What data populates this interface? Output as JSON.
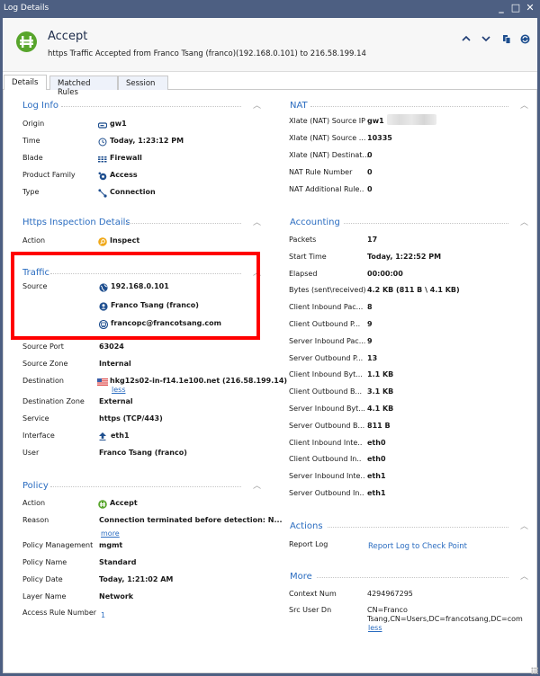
{
  "window": {
    "title": "Log Details",
    "controls": {
      "minimize": "_",
      "maximize": "□",
      "close": "✕"
    }
  },
  "header": {
    "title": "Accept",
    "subtitle": "https Traffic Accepted from Franco Tsang (franco)(192.168.0.101) to 216.58.199.14",
    "icon": "accept-gate-icon",
    "buttons": [
      {
        "name": "previous-log-button",
        "icon": "chevron-up-icon"
      },
      {
        "name": "next-log-button",
        "icon": "chevron-down-icon"
      },
      {
        "name": "copy-button",
        "icon": "copy-icon"
      },
      {
        "name": "refresh-button",
        "icon": "sync-icon"
      }
    ]
  },
  "tabs": [
    {
      "label": "Details",
      "active": true
    },
    {
      "label": "Matched Rules",
      "active": false
    },
    {
      "label": "Session",
      "active": false
    }
  ],
  "left": {
    "log_info": {
      "title": "Log Info",
      "rows": [
        {
          "label": "Origin",
          "value": "gw1",
          "icon": "gateway-icon"
        },
        {
          "label": "Time",
          "value": "Today, 1:23:12 PM",
          "icon": "clock-icon"
        },
        {
          "label": "Blade",
          "value": "Firewall",
          "icon": "firewall-icon"
        },
        {
          "label": "Product Family",
          "value": "Access",
          "icon": "access-icon"
        },
        {
          "label": "Type",
          "value": "Connection",
          "icon": "connection-icon"
        }
      ]
    },
    "https_inspection": {
      "title": "Https Inspection Details",
      "rows": [
        {
          "label": "Action",
          "value": "Inspect",
          "icon": "inspect-icon"
        }
      ]
    },
    "traffic": {
      "title": "Traffic",
      "source_label": "Source",
      "source_values": [
        {
          "value": "192.168.0.101",
          "icon": "globe-icon"
        },
        {
          "value": "Franco Tsang (franco)",
          "icon": "user-icon"
        },
        {
          "value": "francopc@francotsang.com",
          "icon": "computer-icon"
        }
      ],
      "rows": [
        {
          "label": "Source Port",
          "value": "63024"
        },
        {
          "label": "Source Zone",
          "value": "Internal"
        },
        {
          "label": "Destination",
          "value": "hkg12s02-in-f14.1e100.net (216.58.199.14)",
          "icon": "us-flag-icon",
          "link": "less"
        },
        {
          "label": "Destination Zone",
          "value": "External"
        },
        {
          "label": "Service",
          "value": "https (TCP/443)"
        },
        {
          "label": "Interface",
          "value": "eth1",
          "icon": "arrow-up-icon"
        },
        {
          "label": "User",
          "value": "Franco Tsang (franco)"
        }
      ]
    },
    "policy": {
      "title": "Policy",
      "rows": [
        {
          "label": "Action",
          "value": "Accept",
          "icon": "accept-icon"
        },
        {
          "label": "Reason",
          "value": "Connection terminated before detection: N...",
          "link": "more"
        },
        {
          "label": "Policy Management",
          "value": "mgmt"
        },
        {
          "label": "Policy Name",
          "value": "Standard"
        },
        {
          "label": "Policy Date",
          "value": "Today, 1:21:02 AM"
        },
        {
          "label": "Layer Name",
          "value": "Network"
        },
        {
          "label": "Access Rule Number",
          "value": "1"
        }
      ]
    }
  },
  "right": {
    "nat": {
      "title": "NAT",
      "rows": [
        {
          "label": "Xlate (NAT) Source IP",
          "value": "gw1 ("
        },
        {
          "label": "Xlate (NAT) Source ...",
          "value": "10335"
        },
        {
          "label": "Xlate (NAT) Destinat...",
          "value": "0"
        },
        {
          "label": "NAT Rule Number",
          "value": "0"
        },
        {
          "label": "NAT Additional Rule..",
          "value": "0"
        }
      ]
    },
    "accounting": {
      "title": "Accounting",
      "rows": [
        {
          "label": "Packets",
          "value": "17"
        },
        {
          "label": "Start Time",
          "value": "Today, 1:22:52 PM"
        },
        {
          "label": "Elapsed",
          "value": "00:00:00"
        },
        {
          "label": "Bytes (sent\\received)",
          "value": "4.2 KB (811 B \\ 4.1 KB)"
        },
        {
          "label": "Client Inbound Pac...",
          "value": "8"
        },
        {
          "label": "Client Outbound P...",
          "value": "9"
        },
        {
          "label": "Server Inbound Pac...",
          "value": "9"
        },
        {
          "label": "Server Outbound P...",
          "value": "13"
        },
        {
          "label": "Client Inbound Byt...",
          "value": "1.1 KB"
        },
        {
          "label": "Client Outbound B...",
          "value": "3.1 KB"
        },
        {
          "label": "Server Inbound Byt...",
          "value": "4.1 KB"
        },
        {
          "label": "Server Outbound B...",
          "value": "811 B"
        },
        {
          "label": "Client Inbound Inte..",
          "value": "eth0"
        },
        {
          "label": "Client Outbound In..",
          "value": "eth0"
        },
        {
          "label": "Server Inbound Inte..",
          "value": "eth1"
        },
        {
          "label": "Server Outbound In..",
          "value": "eth1"
        }
      ]
    },
    "actions": {
      "title": "Actions",
      "rows": [
        {
          "label": "Report Log",
          "link": "Report Log to Check Point"
        }
      ]
    },
    "more": {
      "title": "More",
      "rows": [
        {
          "label": "Context Num",
          "value": "4294967295"
        },
        {
          "label": "Src User Dn",
          "value_line1": "CN=Franco",
          "value_line2": "Tsang,CN=Users,DC=francotsang,DC=com",
          "link": "less"
        }
      ]
    }
  },
  "colors": {
    "titlebar": "#4d5f82",
    "section_title": "#2a6cc0",
    "accept_green": "#58a52c",
    "icon_blue": "#1f4f8f",
    "highlight_red": "#ff0000"
  }
}
